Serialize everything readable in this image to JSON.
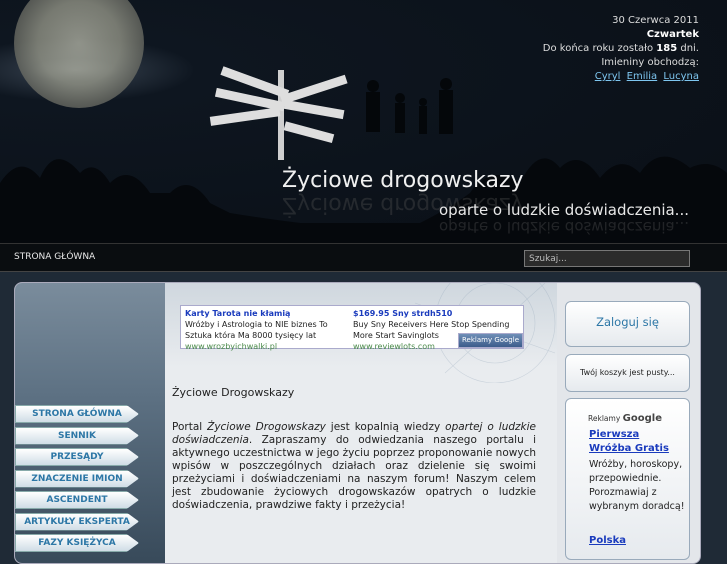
{
  "header": {
    "date": "30 Czerwca 2011",
    "weekday": "Czwartek",
    "days_left_prefix": "Do końca roku zostało",
    "days_left_value": "185",
    "days_left_suffix": "dni.",
    "nameday_label": "Imieniny obchodzą:",
    "namedays": [
      "Cyryl",
      "Emilia",
      "Lucyna"
    ],
    "title": "Życiowe drogowskazy",
    "subtitle": "oparte o ludzkie doświadczenia..."
  },
  "navbar": {
    "home_label": "STRONA GŁÓWNA",
    "search_value": "Szukaj..."
  },
  "ad_top": {
    "ad1_title": "Karty Tarota nie kłamią",
    "ad1_text": "Wróżby i Astrologia to NIE biznes To Sztuka która Ma 8000 tysięcy lat",
    "ad1_url": "www.wrozbyichwalki.pl",
    "ad2_title": "$169.95 Sny strdh510",
    "ad2_text": "Buy Sny Receivers Here Stop Spending More Start Savinglots",
    "ad2_url": "www.reviewlots.com",
    "badge": "Reklamy Google"
  },
  "menu": [
    "STRONA GŁÓWNA",
    "SENNIK",
    "PRZESĄDY",
    "ZNACZENIE IMION",
    "ASCENDENT",
    "ARTYKUŁY EKSPERTA",
    "FAZY KSIĘŻYCA"
  ],
  "content": {
    "heading": "Życiowe Drogowskazy",
    "paragraph_start": "Portal ",
    "portal_name": "Życiowe Drogowskazy",
    "paragraph_mid": " jest kopalnią wiedzy ",
    "phrase": "opartej o ludzkie doświadczenia",
    "paragraph_end": ". Zapraszamy do odwiedzania naszego portalu i aktywnego uczestnictwa w jego życiu poprzez proponowanie nowych wpisów w poszczególnych działach oraz dzielenie się swoimi przeżyciami i doświadczeniami na naszym forum! Naszym celem jest zbudowanie życiowych drogowskazów opatrych o ludzkie doświadczenia, prawdziwe fakty i przeżycia!"
  },
  "sidebar_right": {
    "login_label": "Zaloguj się",
    "cart_text": "Twój koszyk jest pusty...",
    "google_label_prefix": "Reklamy",
    "google_label_brand": "Google",
    "ad_link": "Pierwsza Wróżba Gratis",
    "ad_text": "Wróżby, horoskopy, przepowiednie. Porozmawiaj z wybranym doradcą!",
    "ad_link2": "Polska"
  }
}
